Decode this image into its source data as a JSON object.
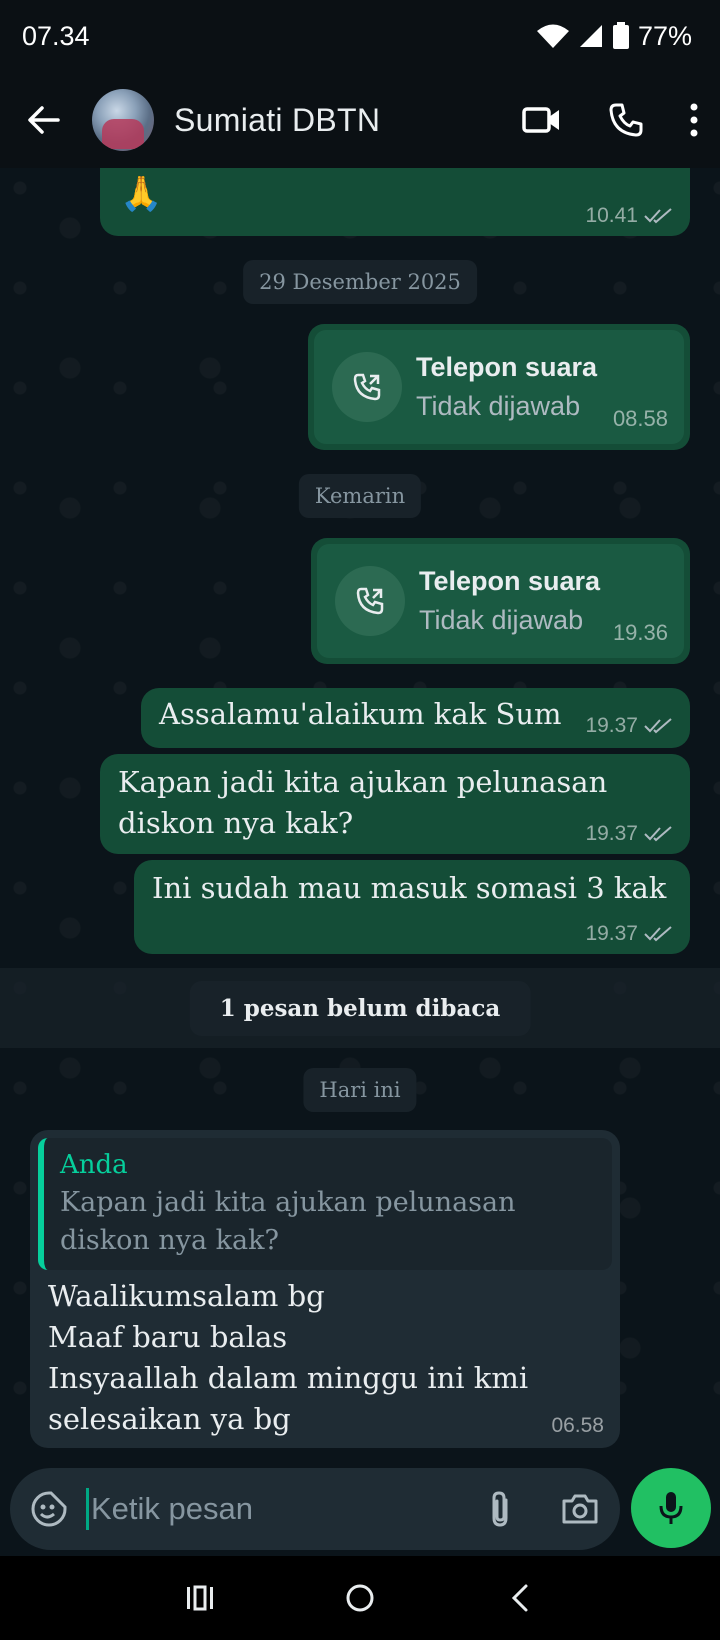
{
  "status_bar": {
    "time": "07.34",
    "battery": "77%"
  },
  "header": {
    "contact_name": "Sumiati DBTN",
    "icons": [
      "back-arrow-icon",
      "avatar",
      "video-call-icon",
      "voice-call-icon",
      "more-vert-icon"
    ]
  },
  "messages": {
    "partial_top": {
      "emoji": "🙏",
      "time": "10.41",
      "status": "read"
    },
    "date_1": "29 Desember 2025",
    "call_1": {
      "title": "Telepon suara",
      "subtitle": "Tidak dijawab",
      "time": "08.58"
    },
    "date_2": "Kemarin",
    "call_2": {
      "title": "Telepon suara",
      "subtitle": "Tidak dijawab",
      "time": "19.36"
    },
    "msg_1": {
      "text": "Assalamu'alaikum kak Sum",
      "time": "19.37"
    },
    "msg_2": {
      "line1": "Kapan jadi kita ajukan pelunasan",
      "line2": "diskon nya kak?",
      "time": "19.37"
    },
    "msg_3": {
      "text": "Ini sudah mau masuk somasi 3 kak",
      "time": "19.37"
    },
    "unread_label": "1 pesan belum dibaca",
    "date_3": "Hari ini",
    "reply": {
      "quote_author": "Anda",
      "quote_line1": "Kapan jadi kita ajukan pelunasan",
      "quote_line2": "diskon nya kak?",
      "line1": "Waalikumsalam bg",
      "line2": "Maaf baru balas",
      "line3": "Insyaallah dalam minggu ini kmi",
      "line4": "selesaikan ya bg",
      "time": "06.58"
    }
  },
  "input": {
    "placeholder": "Ketik pesan"
  },
  "colors": {
    "outgoing_bubble": "#144d37",
    "incoming_bubble": "#1f2c34",
    "accent": "#21c063",
    "quote_accent": "#06cf9c"
  }
}
